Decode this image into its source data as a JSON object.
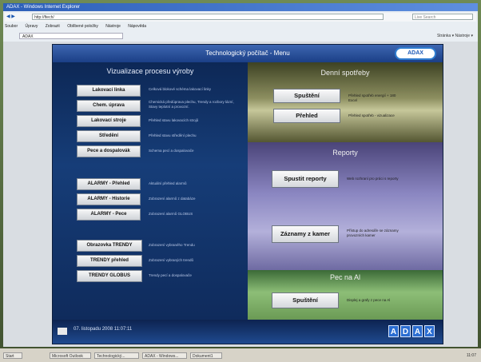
{
  "browser": {
    "title": "ADAX - Windows Internet Explorer",
    "nav_label": "◀ ▶",
    "url": "http://ftech/",
    "search_placeholder": "Live Search",
    "menu": [
      "Soubor",
      "Úpravy",
      "Zobrazit",
      "Oblíbené položky",
      "Nástroje",
      "Nápověda"
    ],
    "tab_label": "ADAX",
    "tools_label": "Stránka ▾  Nástroje ▾"
  },
  "app": {
    "title": "Technologický počítač - Menu",
    "logo": "ADAX",
    "left_heading": "Vizualizace procesu výroby",
    "buttons": [
      {
        "label": "Lakovací linka",
        "desc": "Celková blokové schéma lakovací linky"
      },
      {
        "label": "Chem. úprava",
        "desc": "Chemická předúprava plechu, Trendy a rozbory lázní, Stavy teplotní a provozní."
      },
      {
        "label": "Lakovací stroje",
        "desc": "Přehled stavu lakovacích strojů"
      },
      {
        "label": "Středění",
        "desc": "Přehled stavu středění plechu"
      },
      {
        "label": "Pece a dospalovák",
        "desc": "Schema pecí a dospalovače"
      },
      {
        "label": "ALARMY - Přehled",
        "desc": "Aktuální přehled alarmů"
      },
      {
        "label": "ALARMY - Historie",
        "desc": "Zobrazení alarmů z databáze"
      },
      {
        "label": "ALARMY - Pece",
        "desc": "Zobrazení alarmů GLOBUS"
      },
      {
        "label": "Obrazovka TRENDY",
        "desc": "Zobrazení vybraného Trendu"
      },
      {
        "label": "TRENDY přehled",
        "desc": "Zobrazení vybraných trendů"
      },
      {
        "label": "TRENDY GLOBUS",
        "desc": "Trendy pecí a dospalovače"
      }
    ],
    "sections": {
      "denni": {
        "title": "Denní spotřeby",
        "btn1": "Spuštění",
        "desc1": "Přehled spotřeb energií + 180 Excel",
        "btn2": "Přehled",
        "desc2": "Přehled spotřeb - vizualizace"
      },
      "reporty": {
        "title": "Reporty",
        "btn1": "Spustit reporty",
        "desc1": "Web rozhraní pro práci s reporty",
        "btn2": "Záznamy z kamer",
        "desc2": "Přístup do adresáře se záznamy provozních kamer"
      },
      "pec": {
        "title": "Pec na Al",
        "btn1": "Spuštění",
        "desc1": "Displej a grafy z pece na Al"
      }
    },
    "date": "07. listopadu 2008 11:07:11",
    "adax_letters": [
      "A",
      "D",
      "A",
      "X"
    ]
  },
  "taskbar": {
    "tasks": [
      "Start",
      "Microsoft Outlook",
      "Technologický...",
      "ADAX - Windows...",
      "Dokument1"
    ],
    "tray": "11:07"
  },
  "colors": {
    "panel": "#1e3a6e",
    "accent": "#2b6dd1"
  }
}
